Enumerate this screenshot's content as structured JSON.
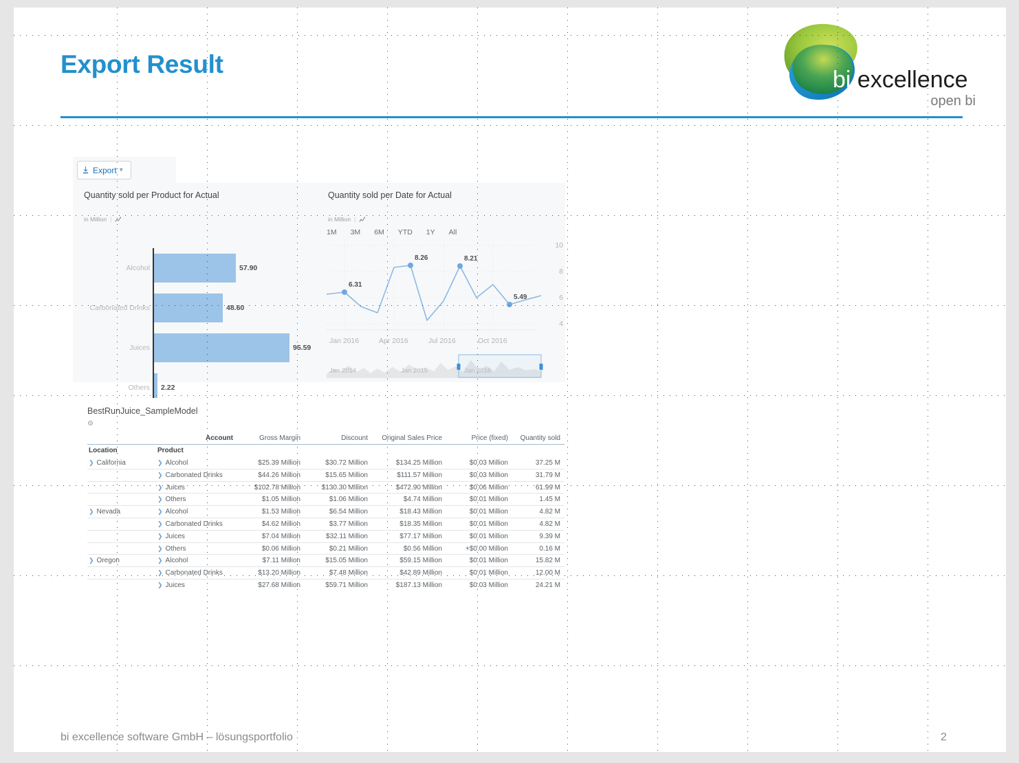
{
  "slide": {
    "title": "Export Result",
    "footer_text": "bi excellence software GmbH – lösungsportfolio",
    "page_number": "2",
    "accent_color": "#2290cd"
  },
  "logo": {
    "brand_bi": "bi",
    "brand_rest": "excellence",
    "tagline": "open bi",
    "green": "#8cc63e",
    "blue": "#1b9dd9"
  },
  "toolbar": {
    "export_label": "Export",
    "export_icon": "download-icon",
    "chevron_icon": "chevron-down-icon"
  },
  "bar_chart": {
    "title": "Quantity sold per Product for Actual",
    "unit": "in Million",
    "settings_icon": "chart-type-icon"
  },
  "line_chart": {
    "title": "Quantity sold per Date for Actual",
    "unit": "in Million",
    "settings_icon": "chart-type-icon",
    "ranges": [
      "1M",
      "3M",
      "6M",
      "YTD",
      "1Y",
      "All"
    ],
    "nav_labels": [
      "Jan 2014",
      "Jan 2015",
      "Jan 2016"
    ]
  },
  "table": {
    "title": "BestRunJuice_SampleModel",
    "gear_icon": "gear-icon",
    "account_header": "Account",
    "measure_headers": [
      "Gross Margin",
      "Discount",
      "Original Sales Price",
      "Price (fixed)",
      "Quantity sold"
    ],
    "dim_headers": [
      "Location",
      "Product"
    ],
    "rows": [
      {
        "location": "California",
        "product": "Alcohol",
        "values": [
          "$25.39 Million",
          "$30.72 Million",
          "$134.25 Million",
          "$0.03 Million",
          "37.25 M"
        ]
      },
      {
        "location": "",
        "product": "Carbonated Drinks",
        "values": [
          "$44.26 Million",
          "$15.65 Million",
          "$111.57 Million",
          "$0.03 Million",
          "31.79 M"
        ]
      },
      {
        "location": "",
        "product": "Juices",
        "values": [
          "$102.78 Million",
          "$130.30 Million",
          "$472.90 Million",
          "$0.06 Million",
          "61.99 M"
        ]
      },
      {
        "location": "",
        "product": "Others",
        "values": [
          "$1.05 Million",
          "$1.06 Million",
          "$4.74 Million",
          "$0.01 Million",
          "1.45 M"
        ]
      },
      {
        "location": "Nevada",
        "product": "Alcohol",
        "values": [
          "$1.53 Million",
          "$6.54 Million",
          "$18.43 Million",
          "$0.01 Million",
          "4.82 M"
        ]
      },
      {
        "location": "",
        "product": "Carbonated Drinks",
        "values": [
          "$4.62 Million",
          "$3.77 Million",
          "$18.35 Million",
          "$0.01 Million",
          "4.82 M"
        ]
      },
      {
        "location": "",
        "product": "Juices",
        "values": [
          "$7.04 Million",
          "$32.11 Million",
          "$77.17 Million",
          "$0.01 Million",
          "9.39 M"
        ]
      },
      {
        "location": "",
        "product": "Others",
        "values": [
          "$0.06 Million",
          "$0.21 Million",
          "$0.56 Million",
          "+$0.00 Million",
          "0.16 M"
        ]
      },
      {
        "location": "Oregon",
        "product": "Alcohol",
        "values": [
          "$7.11 Million",
          "$15.05 Million",
          "$59.15 Million",
          "$0.01 Million",
          "15.82 M"
        ]
      },
      {
        "location": "",
        "product": "Carbonated Drinks",
        "values": [
          "$13.20 Million",
          "$7.48 Million",
          "$42.89 Million",
          "$0.01 Million",
          "12.00 M"
        ]
      },
      {
        "location": "",
        "product": "Juices",
        "values": [
          "$27.68 Million",
          "$59.71 Million",
          "$187.13 Million",
          "$0.03 Million",
          "24.21 M"
        ]
      }
    ]
  },
  "chart_data": [
    {
      "type": "bar",
      "title": "Quantity sold per Product for Actual",
      "orientation": "horizontal",
      "ylabel": "",
      "xlabel": "in Million",
      "categories": [
        "Alcohol",
        "Carbonated Drinks",
        "Juices",
        "Others"
      ],
      "values": [
        57.9,
        48.6,
        95.59,
        2.22
      ],
      "labels": [
        "57.90",
        "48.60",
        "95.59",
        "2.22"
      ],
      "xlim": [
        0,
        110
      ],
      "grid": false,
      "series_color": "#9cc3e8"
    },
    {
      "type": "line",
      "title": "Quantity sold per Date for Actual",
      "xlabel": "",
      "ylabel": "in Million",
      "ylim": [
        3,
        10
      ],
      "yticks": [
        4,
        6,
        8,
        10
      ],
      "xticks": [
        "Jan 2016",
        "Apr 2016",
        "Jul 2016",
        "Oct 2016"
      ],
      "grid": true,
      "series_color": "#8cb8e8",
      "x": [
        "Nov 2015",
        "Dec 2015",
        "Jan 2016",
        "Feb 2016",
        "Mar 2016",
        "Apr 2016",
        "May 2016",
        "Jun 2016",
        "Jul 2016",
        "Aug 2016",
        "Sep 2016",
        "Oct 2016",
        "Nov 2016",
        "Dec 2016"
      ],
      "values": [
        6.15,
        6.31,
        5.55,
        5.25,
        7.7,
        8.26,
        4.5,
        5.85,
        8.21,
        5.85,
        6.85,
        5.49,
        5.7,
        5.95
      ],
      "annotations": [
        {
          "x": "Dec 2015",
          "value": 6.31,
          "label": "6.31"
        },
        {
          "x": "Apr 2016",
          "value": 8.26,
          "label": "8.26"
        },
        {
          "x": "Jul 2016",
          "value": 8.21,
          "label": "8.21"
        },
        {
          "x": "Oct 2016",
          "value": 5.49,
          "label": "5.49"
        }
      ],
      "range_buttons": [
        "1M",
        "3M",
        "6M",
        "YTD",
        "1Y",
        "All"
      ],
      "navigator": {
        "labels": [
          "Jan 2014",
          "Jan 2015",
          "Jan 2016"
        ],
        "selection": [
          0.625,
          1.0
        ]
      }
    }
  ]
}
